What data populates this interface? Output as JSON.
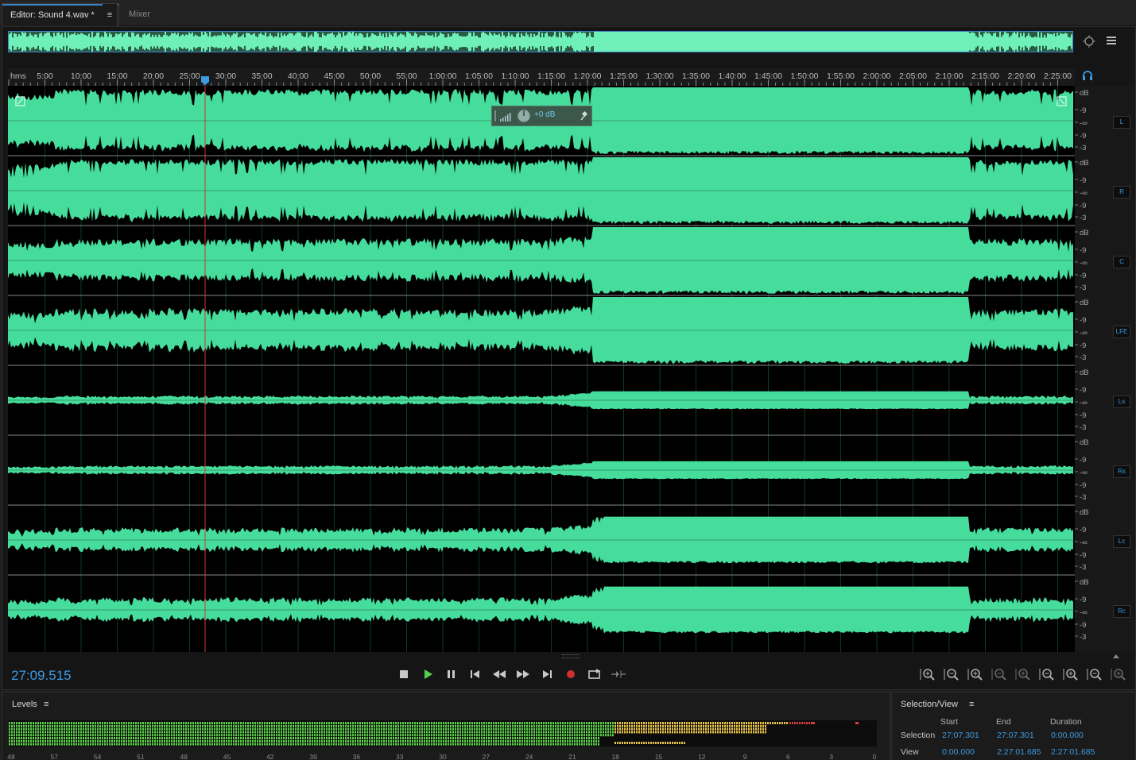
{
  "tabs": {
    "editor_label": "Editor: Sound 4.wav *",
    "menu_glyph": "≡",
    "mixer_label": "Mixer"
  },
  "ruler": {
    "unit_label": "hms",
    "labels": [
      "5:00",
      "10:00",
      "15:00",
      "20:00",
      "25:00",
      "30:00",
      "35:00",
      "40:00",
      "45:00",
      "50:00",
      "55:00",
      "1:00:00",
      "1:05:00",
      "1:10:00",
      "1:15:00",
      "1:20:00",
      "1:25:00",
      "1:30:00",
      "1:35:00",
      "1:40:00",
      "1:45:00",
      "1:50:00",
      "1:55:00",
      "2:00:00",
      "2:05:00",
      "2:10:00",
      "2:15:00",
      "2:20:00",
      "2:25:00"
    ]
  },
  "channels": [
    "L",
    "R",
    "C",
    "LFE",
    "Ls",
    "Rs",
    "Lc",
    "Rc"
  ],
  "db_scale": [
    "dB",
    "-9",
    "-∞",
    "-9",
    "-3"
  ],
  "hud": {
    "gain_label": "+0 dB"
  },
  "timecode": "27:09.515",
  "colors": {
    "waveform": "#45dc9c",
    "overview": "#6ff0b8",
    "accent": "#3d9be0",
    "playhead": "#d33333"
  },
  "transport_icons": [
    "stop-icon",
    "play-icon",
    "pause-icon",
    "skip-start-icon",
    "rewind-icon",
    "fast-forward-icon",
    "skip-end-icon",
    "record-icon",
    "loop-icon",
    "skip-selection-icon"
  ],
  "zoom_icons": [
    "zoom-in-amplitude-icon",
    "zoom-out-amplitude-icon",
    "zoom-in-time-icon",
    "zoom-out-time-icon",
    "zoom-out-full-icon",
    "zoom-in-left-icon",
    "zoom-in-right-icon",
    "zoom-selection-icon",
    "zoom-channels-icon"
  ],
  "levels": {
    "title": "Levels",
    "menu_glyph": "≡",
    "scale": [
      "48",
      "57",
      "54",
      "51",
      "48",
      "45",
      "42",
      "39",
      "36",
      "33",
      "30",
      "27",
      "24",
      "21",
      "18",
      "15",
      "12",
      "9",
      "6",
      "3",
      "0"
    ]
  },
  "selection_view": {
    "title": "Selection/View",
    "menu_glyph": "≡",
    "headers": {
      "start": "Start",
      "end": "End",
      "duration": "Duration"
    },
    "selection": {
      "label": "Selection",
      "start": "27:07.301",
      "end": "27:07.301",
      "duration": "0:00.000"
    },
    "view": {
      "label": "View",
      "start": "0:00.000",
      "end": "2:27:01.685",
      "duration": "2:27:01.685"
    }
  }
}
